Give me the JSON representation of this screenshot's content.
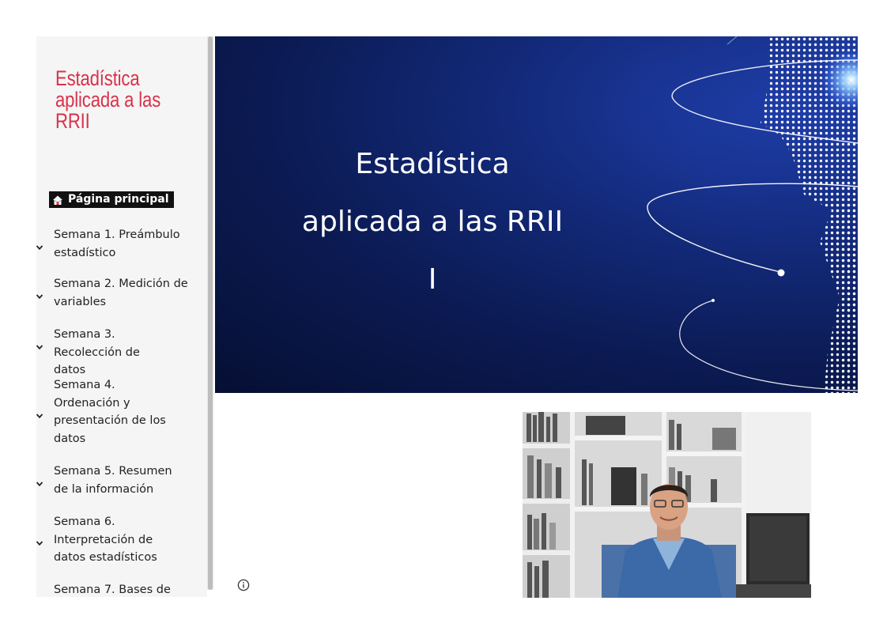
{
  "site": {
    "title": "Estadística aplicada a las RRII"
  },
  "sidebar": {
    "home_label": "Página principal",
    "home_icon": "home-icon",
    "items": [
      {
        "label": "Semana 1. Preámbulo estadístico",
        "icon": "chevron-down-icon"
      },
      {
        "label": "Semana 2. Medición de variables",
        "icon": "chevron-down-icon"
      },
      {
        "label": "Semana 3. Recolección de datos",
        "icon": "chevron-down-icon"
      },
      {
        "label": "Semana 4. Ordenación y presentación de los datos",
        "icon": "chevron-down-icon"
      },
      {
        "label": "Semana 5. Resumen de la información",
        "icon": "chevron-down-icon"
      },
      {
        "label": "Semana 6. Interpretación de datos estadísticos",
        "icon": "chevron-down-icon"
      },
      {
        "label": "Semana 7. Bases de",
        "icon": "chevron-down-icon"
      }
    ]
  },
  "hero": {
    "line1": "Estadística",
    "line2": "aplicada a las RRII",
    "line3": "I"
  },
  "footer": {
    "info_icon": "info-icon"
  },
  "colors": {
    "title_red": "#d8324a",
    "hero_blue": "#0b1a52",
    "home_bg": "#111111"
  }
}
